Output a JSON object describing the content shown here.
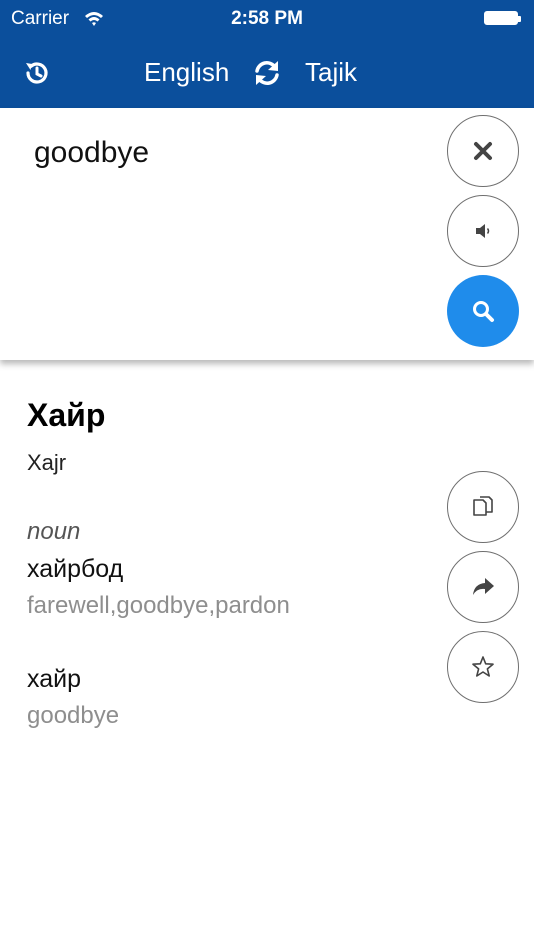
{
  "status_bar": {
    "carrier": "Carrier",
    "time": "2:58 PM"
  },
  "nav": {
    "source_language": "English",
    "target_language": "Tajik"
  },
  "input": {
    "text": "goodbye"
  },
  "result": {
    "headword": "Хайр",
    "transliteration": "Xajr",
    "part_of_speech": "noun",
    "entries": [
      {
        "translation": "хайрбод",
        "synonyms": "farewell,goodbye,pardon"
      },
      {
        "translation": "хайр",
        "synonyms": "goodbye"
      }
    ]
  },
  "colors": {
    "header": "#0b4f9c",
    "accent": "#1f8ceb"
  },
  "icons": [
    "history-icon",
    "swap-icon",
    "clear-icon",
    "speaker-icon",
    "search-icon",
    "copy-icon",
    "share-icon",
    "star-icon",
    "wifi-icon",
    "battery-icon"
  ]
}
